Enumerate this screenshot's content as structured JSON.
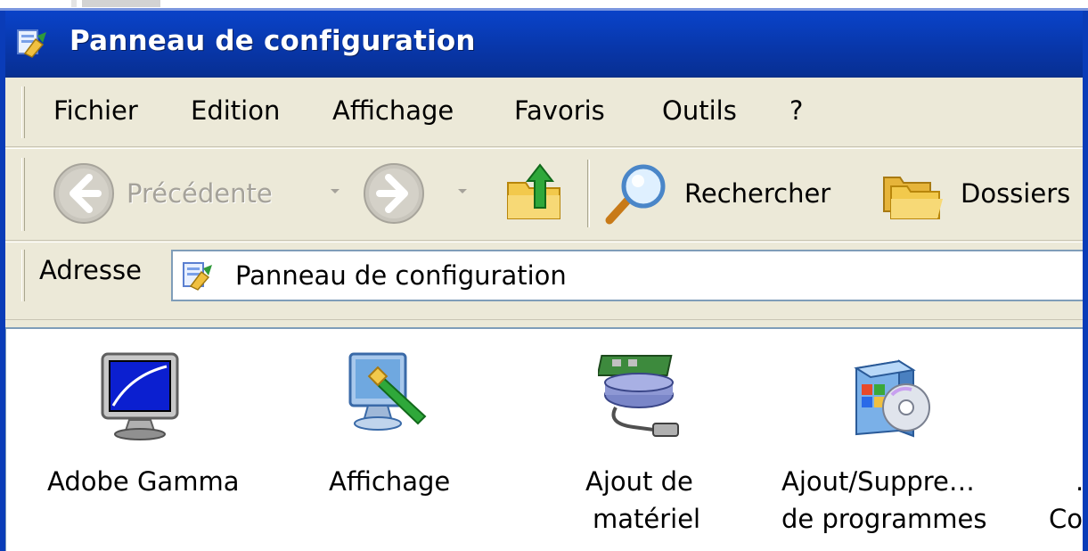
{
  "window": {
    "title": "Panneau de configuration",
    "icon": "control-panel-icon",
    "titlebar_color": "#0a42c8"
  },
  "menubar": {
    "items": [
      {
        "label": "Fichier"
      },
      {
        "label": "Edition"
      },
      {
        "label": "Affichage"
      },
      {
        "label": "Favoris"
      },
      {
        "label": "Outils"
      },
      {
        "label": "?"
      }
    ]
  },
  "toolbar": {
    "back_label": "Précédente",
    "back_enabled": false,
    "forward_enabled": false,
    "search_label": "Rechercher",
    "folders_label": "Dossiers"
  },
  "address": {
    "label": "Adresse",
    "value": "Panneau de configuration"
  },
  "items": [
    {
      "label_line1": "Adobe Gamma",
      "label_line2": "",
      "icon": "adobe-gamma-monitor-icon"
    },
    {
      "label_line1": "Affichage",
      "label_line2": "",
      "icon": "display-properties-icon"
    },
    {
      "label_line1": "Ajout de",
      "label_line2": "matériel",
      "icon": "add-hardware-icon"
    },
    {
      "label_line1": "Ajout/Suppre…",
      "label_line2": "de programmes",
      "icon": "add-remove-programs-icon"
    },
    {
      "label_line1": ".",
      "label_line2": "Co",
      "icon": "partial-item-icon"
    }
  ]
}
